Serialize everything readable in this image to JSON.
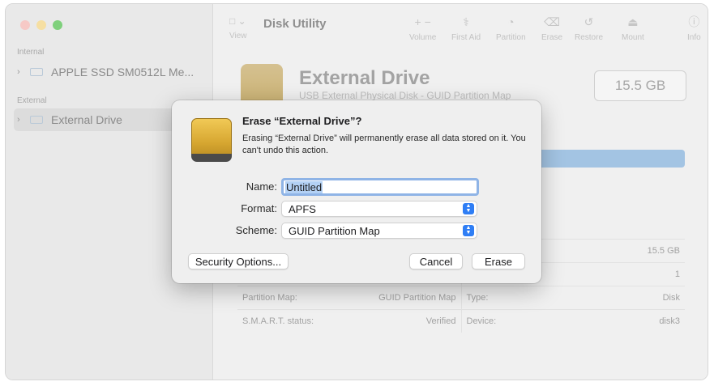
{
  "sidebar": {
    "sections": [
      {
        "label": "Internal",
        "items": [
          {
            "label": "APPLE SSD SM0512L Me..."
          }
        ]
      },
      {
        "label": "External",
        "items": [
          {
            "label": "External Drive"
          }
        ]
      }
    ]
  },
  "toolbar": {
    "view_label": "View",
    "app_title": "Disk Utility",
    "buttons": [
      {
        "label": "Volume",
        "icon": "+  −"
      },
      {
        "label": "First Aid",
        "icon": "⚕"
      },
      {
        "label": "Partition",
        "icon": "◔"
      },
      {
        "label": "Erase",
        "icon": "⌫"
      },
      {
        "label": "Restore",
        "icon": "↺"
      },
      {
        "label": "Mount",
        "icon": "⏏"
      },
      {
        "label": "Info",
        "icon": "ⓘ"
      }
    ]
  },
  "disk_header": {
    "title": "External Drive",
    "subtitle": "USB External Physical Disk - GUID Partition Map",
    "capacity": "15.5 GB"
  },
  "info_table": {
    "rows": [
      {
        "left_label": "",
        "left_value": "",
        "right_label": "",
        "right_value": "15.5 GB"
      },
      {
        "left_label": "",
        "left_value": "",
        "right_label": "",
        "right_value": "1"
      },
      {
        "left_label": "Partition Map:",
        "left_value": "GUID Partition Map",
        "right_label": "Type:",
        "right_value": "Disk"
      },
      {
        "left_label": "S.M.A.R.T. status:",
        "left_value": "Verified",
        "right_label": "Device:",
        "right_value": "disk3"
      }
    ]
  },
  "dialog": {
    "title": "Erase “External Drive”?",
    "message": "Erasing “External Drive” will permanently erase all data stored on it. You can't undo this action.",
    "name_label": "Name:",
    "name_value": "Untitled",
    "format_label": "Format:",
    "format_value": "APFS",
    "scheme_label": "Scheme:",
    "scheme_value": "GUID Partition Map",
    "security_button": "Security Options...",
    "cancel_button": "Cancel",
    "erase_button": "Erase"
  }
}
